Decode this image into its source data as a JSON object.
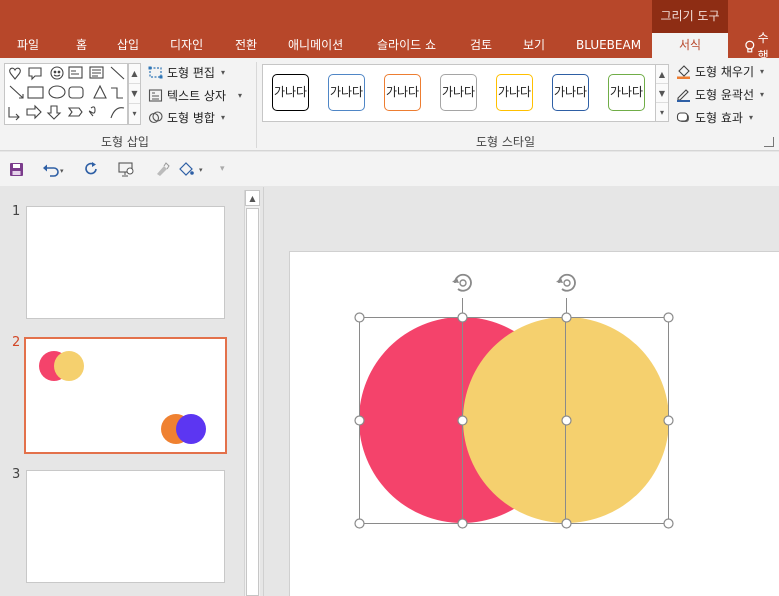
{
  "tabs": {
    "context_group": "그리기 도구",
    "items": [
      "파일",
      "홈",
      "삽입",
      "디자인",
      "전환",
      "애니메이션",
      "슬라이드 쇼",
      "검토",
      "보기",
      "BLUEBEAM",
      "서식"
    ],
    "tell_me": "수행"
  },
  "ribbon": {
    "insert_shapes": {
      "label": "도형 삽입",
      "edit_shape": "도형 편집",
      "text_box": "텍스트 상자",
      "merge_shapes": "도형 병합"
    },
    "shape_styles": {
      "label": "도형 스타일",
      "swatch_text": "가나다",
      "swatch_colors": [
        "#000000",
        "#4f86c6",
        "#ed7d31",
        "#a5a5a5",
        "#ffc000",
        "#2e5fa5",
        "#70ad47"
      ],
      "fill": "도형 채우기",
      "outline": "도형 윤곽선",
      "effects": "도형 효과"
    }
  },
  "slides": [
    {
      "number": "1",
      "active": false
    },
    {
      "number": "2",
      "active": true
    },
    {
      "number": "3",
      "active": false
    }
  ],
  "colors": {
    "accent": "#b7472a",
    "circle_red": "#f4436b",
    "circle_yellow": "#f5d06e",
    "circle_orange": "#ef8131",
    "circle_blue": "#5c36f2"
  }
}
